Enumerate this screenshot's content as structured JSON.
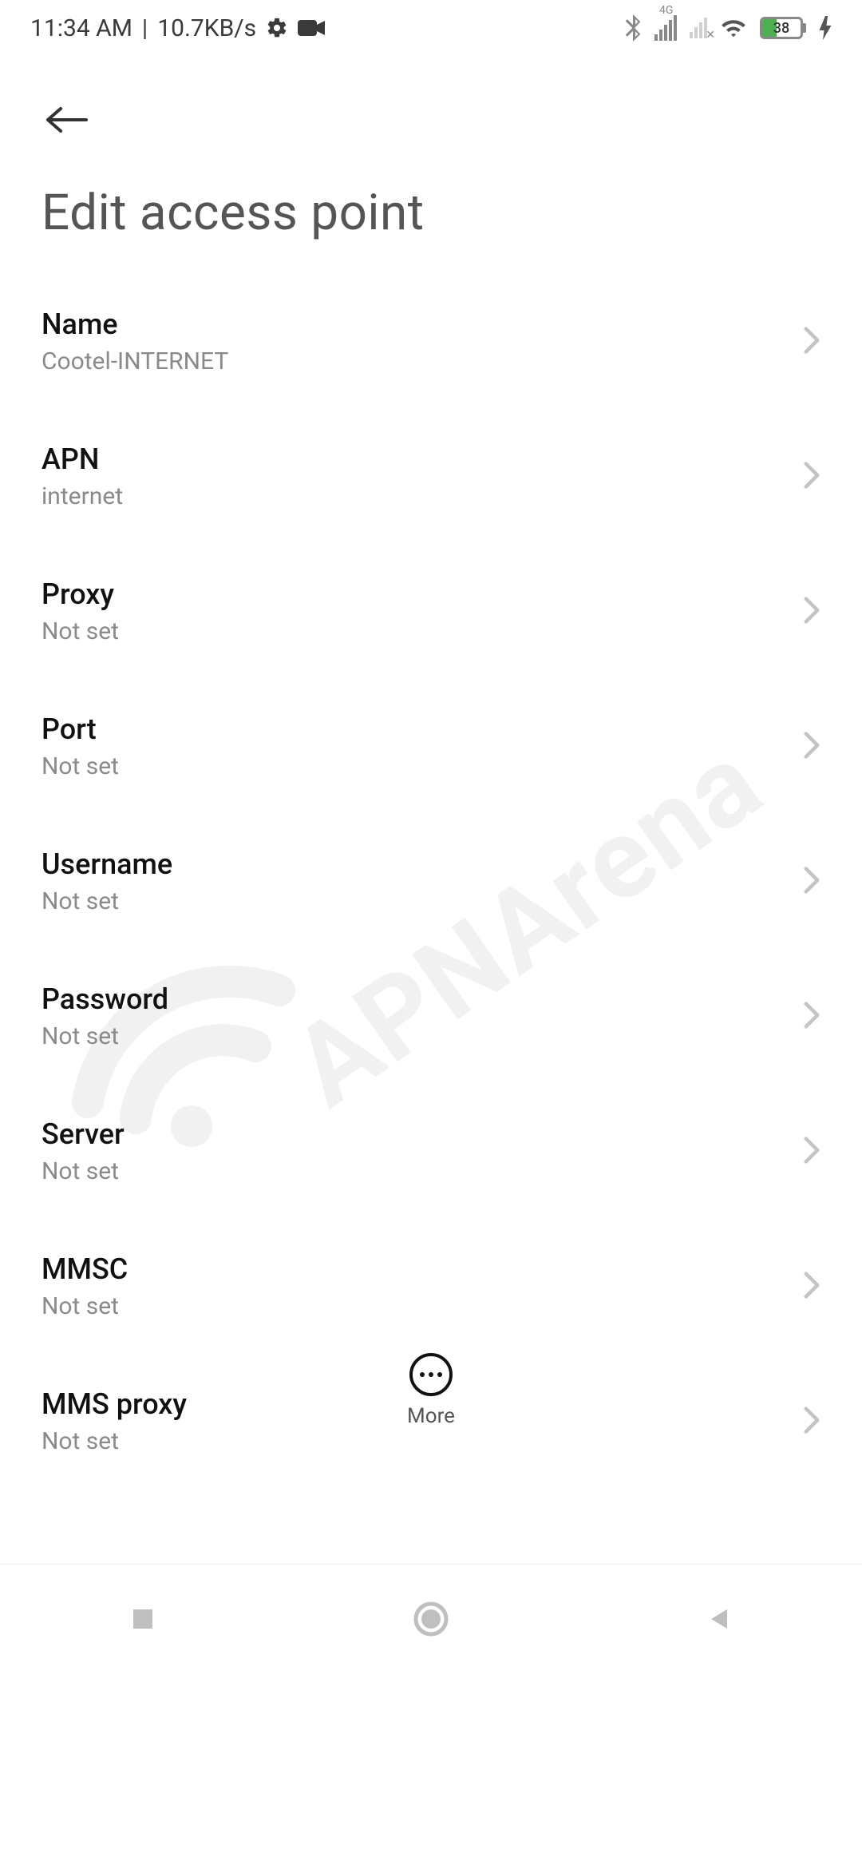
{
  "status": {
    "time": "11:34 AM",
    "net_speed": "10.7KB/s",
    "signal_label": "4G",
    "battery_percent": "38"
  },
  "header": {
    "title": "Edit access point"
  },
  "rows": [
    {
      "title": "Name",
      "value": "Cootel-INTERNET"
    },
    {
      "title": "APN",
      "value": "internet"
    },
    {
      "title": "Proxy",
      "value": "Not set"
    },
    {
      "title": "Port",
      "value": "Not set"
    },
    {
      "title": "Username",
      "value": "Not set"
    },
    {
      "title": "Password",
      "value": "Not set"
    },
    {
      "title": "Server",
      "value": "Not set"
    },
    {
      "title": "MMSC",
      "value": "Not set"
    },
    {
      "title": "MMS proxy",
      "value": "Not set"
    }
  ],
  "more_label": "More",
  "watermark_text": "APNArena"
}
